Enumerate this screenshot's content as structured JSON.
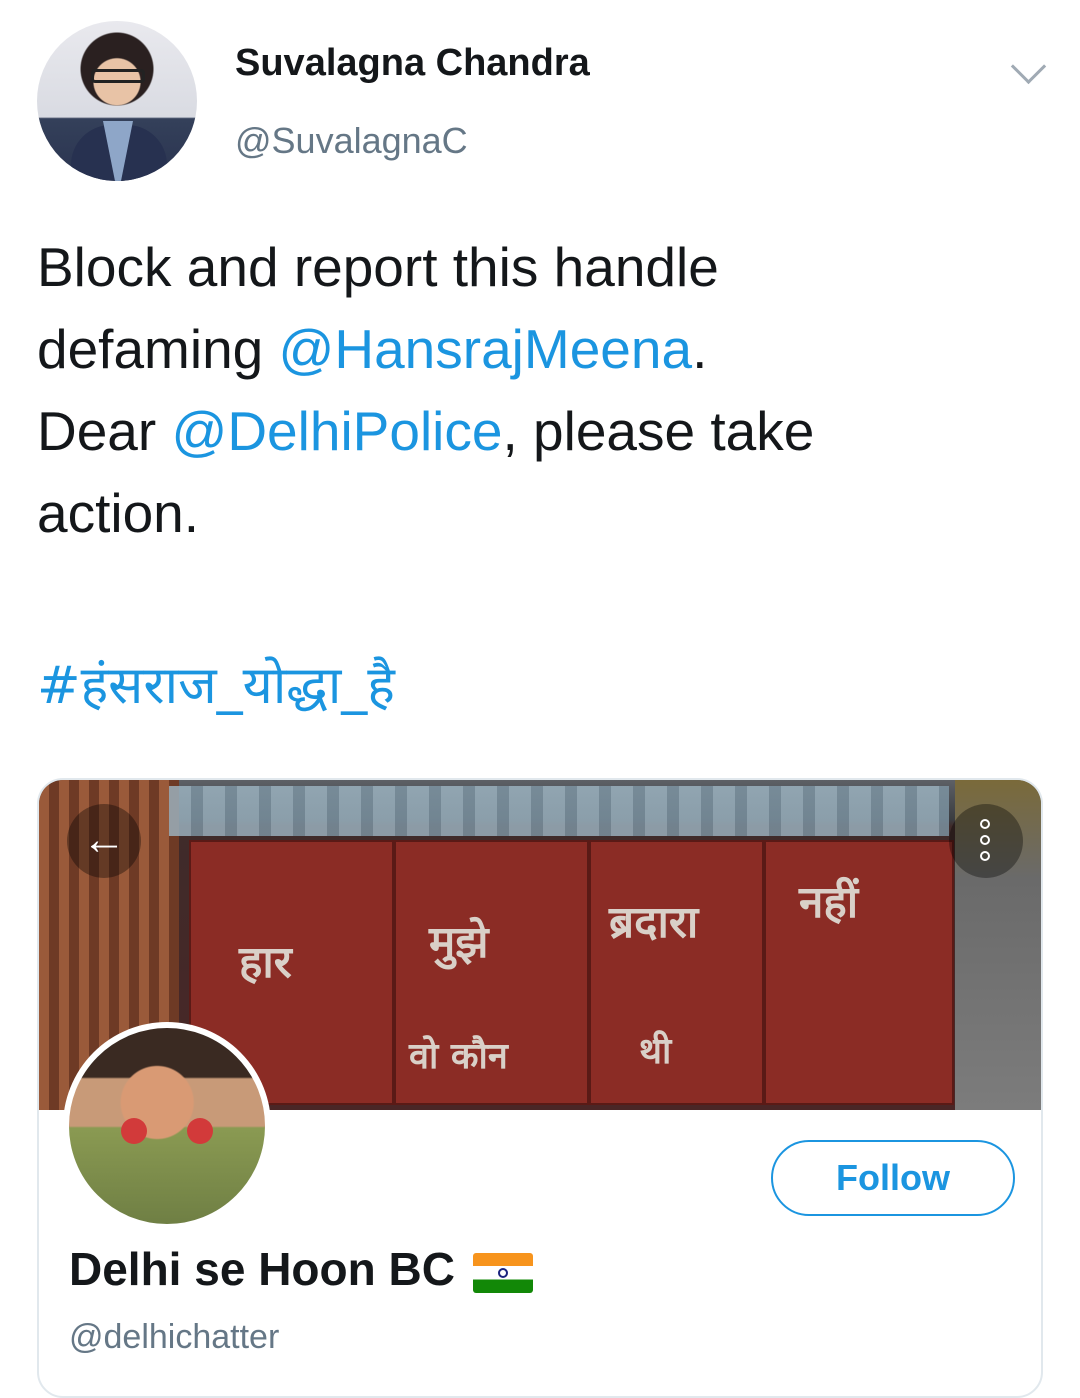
{
  "tweet": {
    "author_name": "Suvalagna Chandra",
    "author_handle": "@SuvalagnaC",
    "text_line1": "Block and report this handle",
    "text_line2_prefix": "defaming ",
    "mention1": "@HansrajMeena",
    "text_line2_suffix": ".",
    "text_line3_prefix": "Dear ",
    "mention2": "@DelhiPolice",
    "text_line3_suffix": ", please take",
    "text_line4": "action.",
    "hashtag": "#हंसराज_योद्धा_है"
  },
  "card": {
    "banner_words": [
      "हार",
      "मुझे",
      "ब्रदारा",
      "नहीं",
      "वो कौन",
      "थी"
    ],
    "follow_label": "Follow",
    "profile_name": "Delhi se Hoon BC",
    "profile_handle": "@delhichatter",
    "flag_icon": "india-flag-icon"
  },
  "icons": {
    "chevron": "chevron-down-icon",
    "back": "back-arrow-icon",
    "more": "more-options-icon"
  },
  "colors": {
    "link": "#1b95e0",
    "secondary_text": "#657786",
    "border": "#e1e8ed"
  }
}
